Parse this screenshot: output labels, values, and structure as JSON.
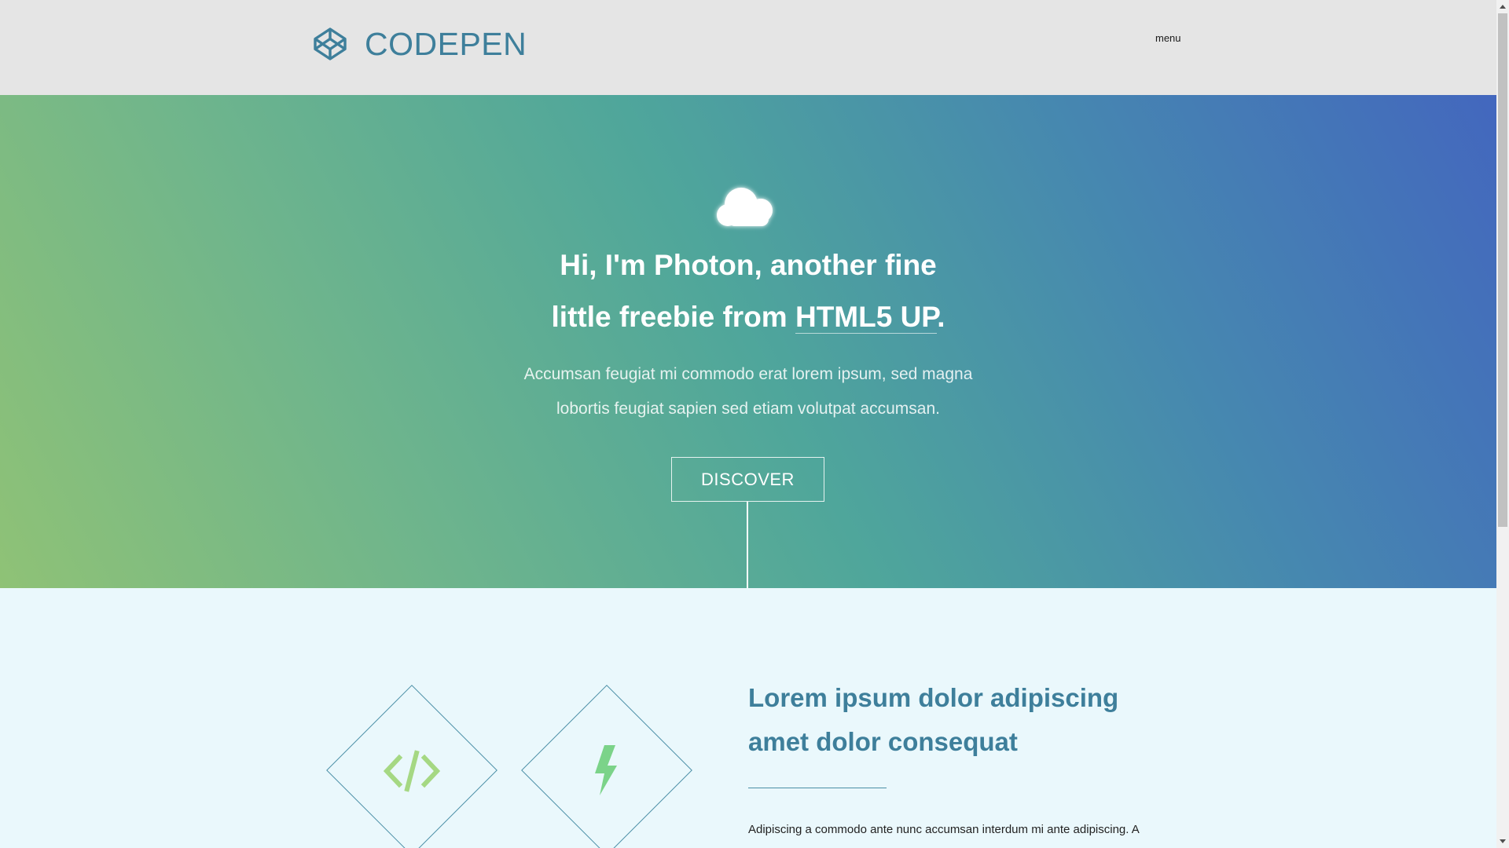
{
  "header": {
    "logo_text": "CODEPEN",
    "logo_icon": "codepen-cube-icon",
    "menu_label": "menu"
  },
  "hero": {
    "icon": "cloud-icon",
    "title_line1": "Hi, I'm Photon, another fine",
    "title_line2_prefix": "little freebie from ",
    "title_link": "HTML5 UP",
    "title_suffix": ".",
    "text_line1": "Accumsan feugiat mi commodo erat lorem ipsum, sed magna",
    "text_line2": "lobortis feugiat sapien sed etiam volutpat accumsan.",
    "button_label": "DISCOVER"
  },
  "features": {
    "icons": [
      "code-icon",
      "bolt-icon"
    ],
    "title_line1": "Lorem ipsum dolor adipiscing",
    "title_line2": "amet dolor consequat",
    "text": "Adipiscing a commodo ante nunc accumsan interdum mi ante adipiscing. A"
  },
  "colors": {
    "header_bg": "#e5e5e5",
    "brand": "#3e7f9b",
    "gradient_start": "#8fc276",
    "gradient_mid": "#4fa69b",
    "gradient_end": "#4367be",
    "section_bg": "#eaf8fc",
    "icon_green": "#7bd389"
  }
}
